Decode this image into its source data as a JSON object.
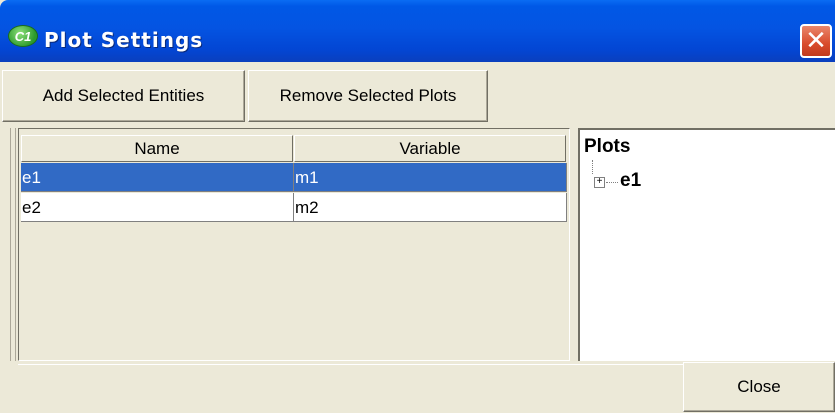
{
  "window": {
    "title": "Plot Settings",
    "app_icon_text": "C1",
    "close_glyph": "✕"
  },
  "toolbar": {
    "add_label": "Add Selected Entities",
    "remove_label": "Remove Selected Plots"
  },
  "table": {
    "columns": [
      "Name",
      "Variable"
    ],
    "rows": [
      {
        "name": "e1",
        "variable": "m1",
        "selected": true
      },
      {
        "name": "e2",
        "variable": "m2",
        "selected": false
      }
    ]
  },
  "tree": {
    "root": "Plots",
    "nodes": [
      {
        "label": "e1",
        "expander": "+"
      }
    ]
  },
  "footer": {
    "close_label": "Close"
  },
  "colors": {
    "titlebar": "#0454e2",
    "selection": "#316ac5",
    "close_button": "#d94b2b",
    "background": "#ece9d8"
  }
}
